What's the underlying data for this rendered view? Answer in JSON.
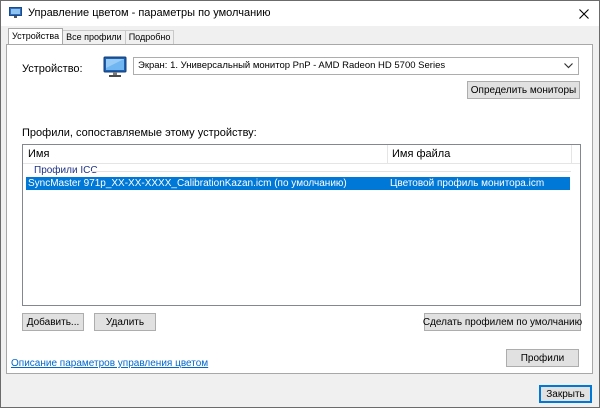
{
  "window": {
    "title": "Управление цветом - параметры по умолчанию"
  },
  "tabs": [
    {
      "label": "Устройства",
      "active": true
    },
    {
      "label": "Все профили",
      "active": false
    },
    {
      "label": "Подробно",
      "active": false
    }
  ],
  "device": {
    "label": "Устройство:",
    "selected": "Экран: 1. Универсальный монитор PnP - AMD Radeon HD 5700 Series",
    "detect_button": "Определить мониторы"
  },
  "profiles": {
    "label": "Профили, сопоставляемые этому устройству:",
    "columns": {
      "name": "Имя",
      "file": "Имя файла"
    },
    "group": "Профили ICC",
    "rows": [
      {
        "name": "SyncMaster 971p_XX-XX-XXXX_CalibrationKazan.icm (по умолчанию)",
        "file": "Цветовой профиль монитора.icm",
        "selected": true
      }
    ]
  },
  "buttons": {
    "add": "Добавить...",
    "remove": "Удалить",
    "set_default": "Сделать профилем по умолчанию",
    "profiles": "Профили",
    "close": "Закрыть"
  },
  "link": {
    "description": "Описание параметров управления цветом"
  },
  "colors": {
    "selection": "#0078d7",
    "link": "#0066cc",
    "group_label": "#1e3287"
  }
}
